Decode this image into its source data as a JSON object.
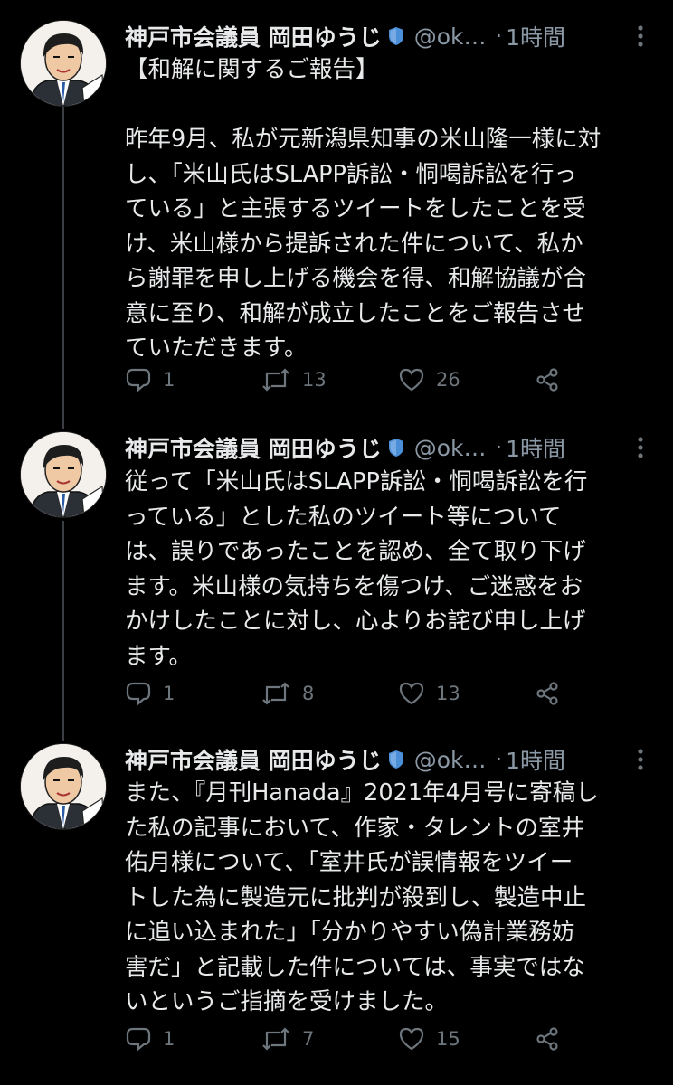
{
  "tweets": [
    {
      "name": "神戸市会議員 岡田ゆうじ",
      "handle": "@ok…",
      "separator": "·",
      "time": "1時間",
      "lines": [
        "【和解に関するご報告】",
        "",
        "昨年9月、私が元新潟県知事の米山隆一様に対",
        "し、「米山氏はSLAPP訴訟・恫喝訴訟を行っ",
        "ている」と主張するツイートをしたことを受",
        "け、米山様から提訴された件について、私か",
        "ら謝罪を申し上げる機会を得、和解協議が合",
        "意に至り、和解が成立したことをご報告させ",
        "ていただきます。"
      ],
      "replies": "1",
      "retweets": "13",
      "likes": "26"
    },
    {
      "name": "神戸市会議員 岡田ゆうじ",
      "handle": "@ok…",
      "separator": "·",
      "time": "1時間",
      "lines": [
        "従って「米山氏はSLAPP訴訟・恫喝訴訟を行",
        "っている」とした私のツイート等について",
        "は、誤りであったことを認め、全て取り下げ",
        "ます。米山様の気持ちを傷つけ、ご迷惑をお",
        "かけしたことに対し、心よりお詫び申し上げ",
        "ます。"
      ],
      "replies": "1",
      "retweets": "8",
      "likes": "13"
    },
    {
      "name": "神戸市会議員 岡田ゆうじ",
      "handle": "@ok…",
      "separator": "·",
      "time": "1時間",
      "lines": [
        "また、『月刊Hanada』2021年4月号に寄稿し",
        "た私の記事において、作家・タレントの室井",
        "佑月様について、「室井氏が誤情報をツイー",
        "トした為に製造元に批判が殺到し、製造中止",
        "に追い込まれた」「分かりやすい偽計業務妨",
        "害だ」と記載した件については、事実ではな",
        "いというご指摘を受けました。"
      ],
      "replies": "1",
      "retweets": "7",
      "likes": "15"
    }
  ],
  "icons": {
    "verified": "verified-badge-icon",
    "more": "more-vertical-icon",
    "reply": "reply-icon",
    "retweet": "retweet-icon",
    "like": "heart-icon",
    "share": "share-icon"
  },
  "colors": {
    "background": "#000000",
    "text": "#e7e9ea",
    "secondary": "#8b98a5",
    "action": "#6e767d",
    "thread_line": "#3b3f43",
    "verified": "#4a8fd8"
  }
}
